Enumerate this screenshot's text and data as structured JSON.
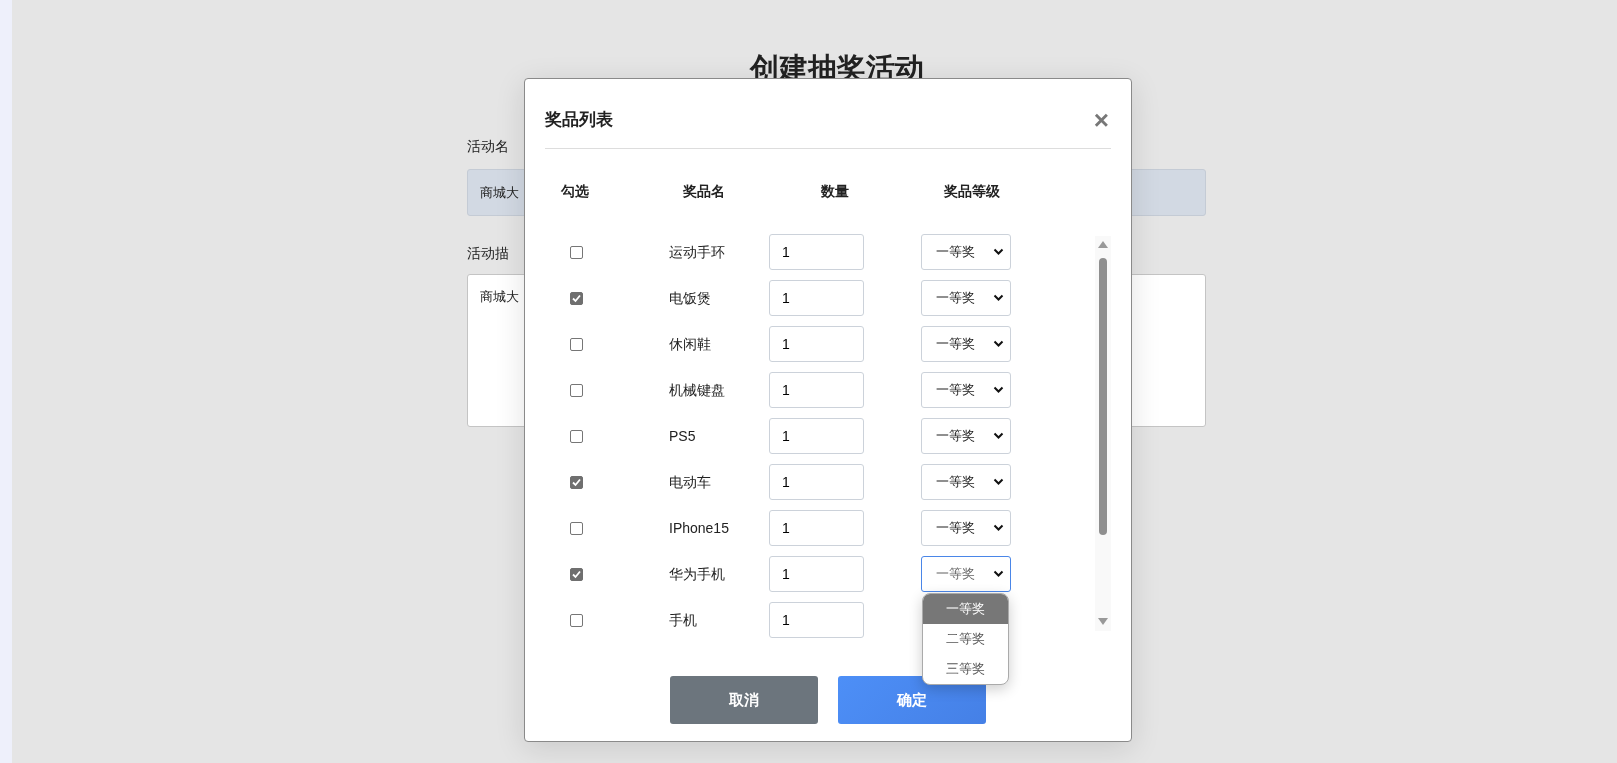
{
  "page": {
    "title": "创建抽奖活动",
    "fields": [
      {
        "label": "活动名",
        "value": "商城大",
        "kind": "input"
      },
      {
        "label": "活动描",
        "value": "商城大",
        "kind": "textarea"
      }
    ]
  },
  "modal": {
    "title": "奖品列表",
    "close": "×",
    "columns": [
      "勾选",
      "奖品名",
      "数量",
      "奖品等级"
    ],
    "rows": [
      {
        "checked": false,
        "name": "运动手环",
        "quantity": "1",
        "grade": "一等奖",
        "focused": false
      },
      {
        "checked": true,
        "name": "电饭煲",
        "quantity": "1",
        "grade": "一等奖",
        "focused": false
      },
      {
        "checked": false,
        "name": "休闲鞋",
        "quantity": "1",
        "grade": "一等奖",
        "focused": false
      },
      {
        "checked": false,
        "name": "机械键盘",
        "quantity": "1",
        "grade": "一等奖",
        "focused": false
      },
      {
        "checked": false,
        "name": "PS5",
        "quantity": "1",
        "grade": "一等奖",
        "focused": false
      },
      {
        "checked": true,
        "name": "电动车",
        "quantity": "1",
        "grade": "一等奖",
        "focused": false
      },
      {
        "checked": false,
        "name": "IPhone15",
        "quantity": "1",
        "grade": "一等奖",
        "focused": false
      },
      {
        "checked": true,
        "name": "华为手机",
        "quantity": "1",
        "grade": "一等奖",
        "focused": true,
        "options": [
          {
            "label": "一等奖",
            "selected": true
          },
          {
            "label": "二等奖",
            "selected": false
          },
          {
            "label": "三等奖",
            "selected": false
          }
        ]
      },
      {
        "checked": false,
        "name": "手机",
        "quantity": "1"
      }
    ],
    "buttons": [
      {
        "label": "取消",
        "kind": "secondary"
      },
      {
        "label": "确定",
        "kind": "primary"
      }
    ]
  }
}
